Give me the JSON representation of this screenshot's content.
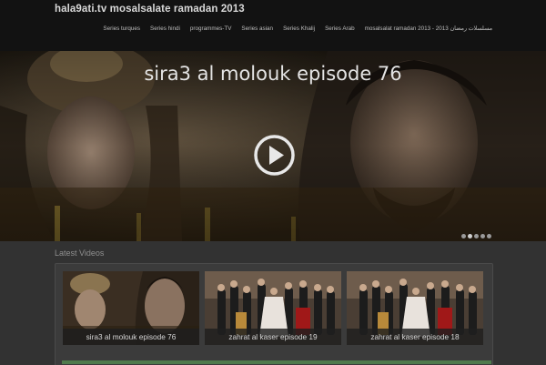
{
  "site": {
    "title": "hala9ati.tv mosalsalate ramadan 2013"
  },
  "nav": {
    "items": [
      "Series turques",
      "Series hindi",
      "programmes-TV",
      "Series asian",
      "Series Khalij",
      "Series Arab",
      "mosalsalat ramadan 2013 - مسلسلات رمضان 2013"
    ]
  },
  "hero": {
    "title": "sira3 al molouk episode 76",
    "play_icon": "play-circle-icon",
    "slides": 5,
    "active_slide": 1
  },
  "latest": {
    "title": "Latest Videos",
    "videos": [
      {
        "caption": "sira3 al molouk episode 76"
      },
      {
        "caption": "zahrat al kaser episode 19"
      },
      {
        "caption": "zahrat al kaser episode 18"
      }
    ]
  },
  "colors": {
    "header_bg": "#121212",
    "page_bg": "#323232",
    "text_light": "#d8d8d8",
    "caption_bg": "#1e1e1e"
  }
}
